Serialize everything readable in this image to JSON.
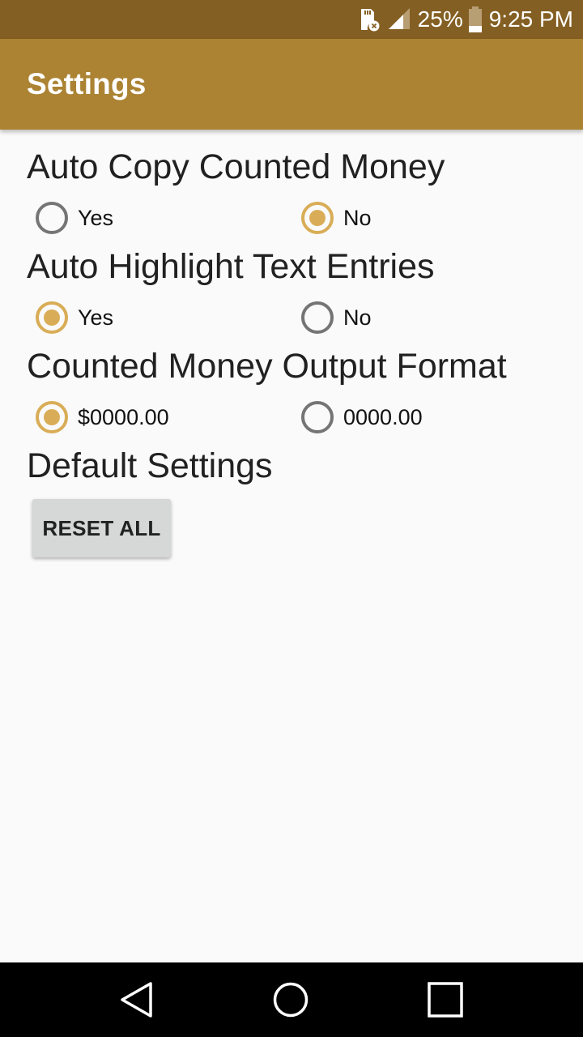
{
  "status_bar": {
    "battery_percent": "25%",
    "time": "9:25 PM",
    "icons": [
      "sd-card-error-icon",
      "signal-icon",
      "battery-icon"
    ]
  },
  "app_bar": {
    "title": "Settings"
  },
  "settings": [
    {
      "title": "Auto Copy Counted Money",
      "options": [
        {
          "label": "Yes",
          "checked": false
        },
        {
          "label": "No",
          "checked": true
        }
      ]
    },
    {
      "title": "Auto Highlight Text Entries",
      "options": [
        {
          "label": "Yes",
          "checked": true
        },
        {
          "label": "No",
          "checked": false
        }
      ]
    },
    {
      "title": "Counted Money Output Format",
      "options": [
        {
          "label": "$0000.00",
          "checked": true
        },
        {
          "label": "0000.00",
          "checked": false
        }
      ]
    }
  ],
  "default_settings": {
    "title": "Default Settings",
    "reset_button_label": "RESET ALL"
  },
  "nav_bar": {
    "icons": [
      "back-icon",
      "home-icon",
      "recents-icon"
    ]
  },
  "colors": {
    "status_bar": "#845f23",
    "app_bar": "#ab8333",
    "accent": "#d9ad57",
    "unchecked": "#757575"
  }
}
